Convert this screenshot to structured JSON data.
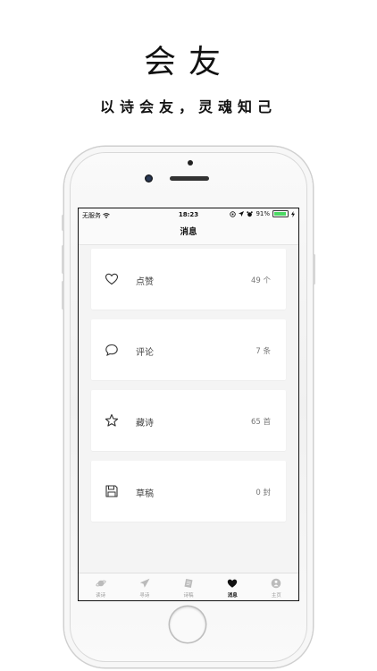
{
  "hero": {
    "title": "会友",
    "subtitle": "以诗会友，灵魂知己"
  },
  "status_bar": {
    "carrier": "无服务",
    "time": "18:23",
    "battery_percent": "91%",
    "battery_level": 0.91
  },
  "nav": {
    "title": "消息"
  },
  "cards": [
    {
      "icon": "heart-icon",
      "label": "点赞",
      "count": "49 个"
    },
    {
      "icon": "comment-bubble-icon",
      "label": "评论",
      "count": "7 条"
    },
    {
      "icon": "star-icon",
      "label": "藏诗",
      "count": "65 首"
    },
    {
      "icon": "floppy-disk-icon",
      "label": "草稿",
      "count": "0 封"
    }
  ],
  "tabs": [
    {
      "icon": "planet-icon",
      "label": "读诗",
      "active": false
    },
    {
      "icon": "paper-plane-icon",
      "label": "寻诗",
      "active": false
    },
    {
      "icon": "notebook-icon",
      "label": "诗稿",
      "active": false
    },
    {
      "icon": "heart-filled-icon",
      "label": "消息",
      "active": true
    },
    {
      "icon": "profile-icon",
      "label": "主页",
      "active": false
    }
  ],
  "colors": {
    "battery_green": "#4cd964",
    "active_tab": "#111111",
    "inactive_tab": "#999999"
  }
}
